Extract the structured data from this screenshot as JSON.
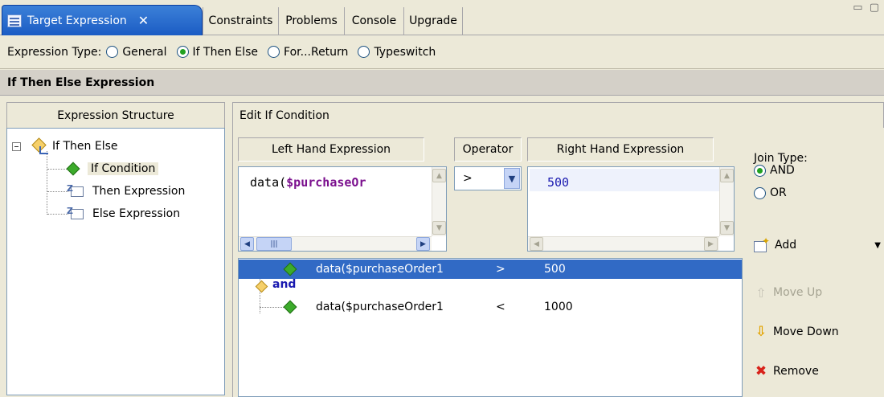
{
  "tabs": {
    "active": {
      "label": "Target Expression",
      "close": "✕"
    },
    "others": [
      "Constraints",
      "Problems",
      "Console",
      "Upgrade"
    ],
    "window_controls": "▭ ▢"
  },
  "expression_type": {
    "label": "Expression Type:",
    "options": [
      "General",
      "If Then Else",
      "For...Return",
      "Typeswitch"
    ],
    "selected": "If Then Else"
  },
  "section_title": "If Then Else Expression",
  "structure": {
    "header": "Expression Structure",
    "root": "If Then Else",
    "children": [
      "If Condition",
      "Then Expression",
      "Else Expression"
    ],
    "selected": "If Condition"
  },
  "edit": {
    "header": "Edit If Condition",
    "left_header": "Left Hand Expression",
    "operator_header": "Operator",
    "right_header": "Right Hand Expression",
    "left_value_prefix": "data(",
    "left_value_var": "$purchaseOr",
    "operator_value": ">",
    "right_value": "500"
  },
  "join": {
    "label": "Join Type:",
    "options": [
      "AND",
      "OR"
    ],
    "selected": "AND"
  },
  "actions": {
    "add": "Add",
    "move_up": "Move Up",
    "move_down": "Move Down",
    "remove": "Remove"
  },
  "conditions": {
    "joiner": "and",
    "rows": [
      {
        "expr": "data($purchaseOrder1",
        "op": ">",
        "value": "500",
        "selected": true
      },
      {
        "expr": "data($purchaseOrder1",
        "op": "<",
        "value": "1000",
        "selected": false
      }
    ]
  }
}
